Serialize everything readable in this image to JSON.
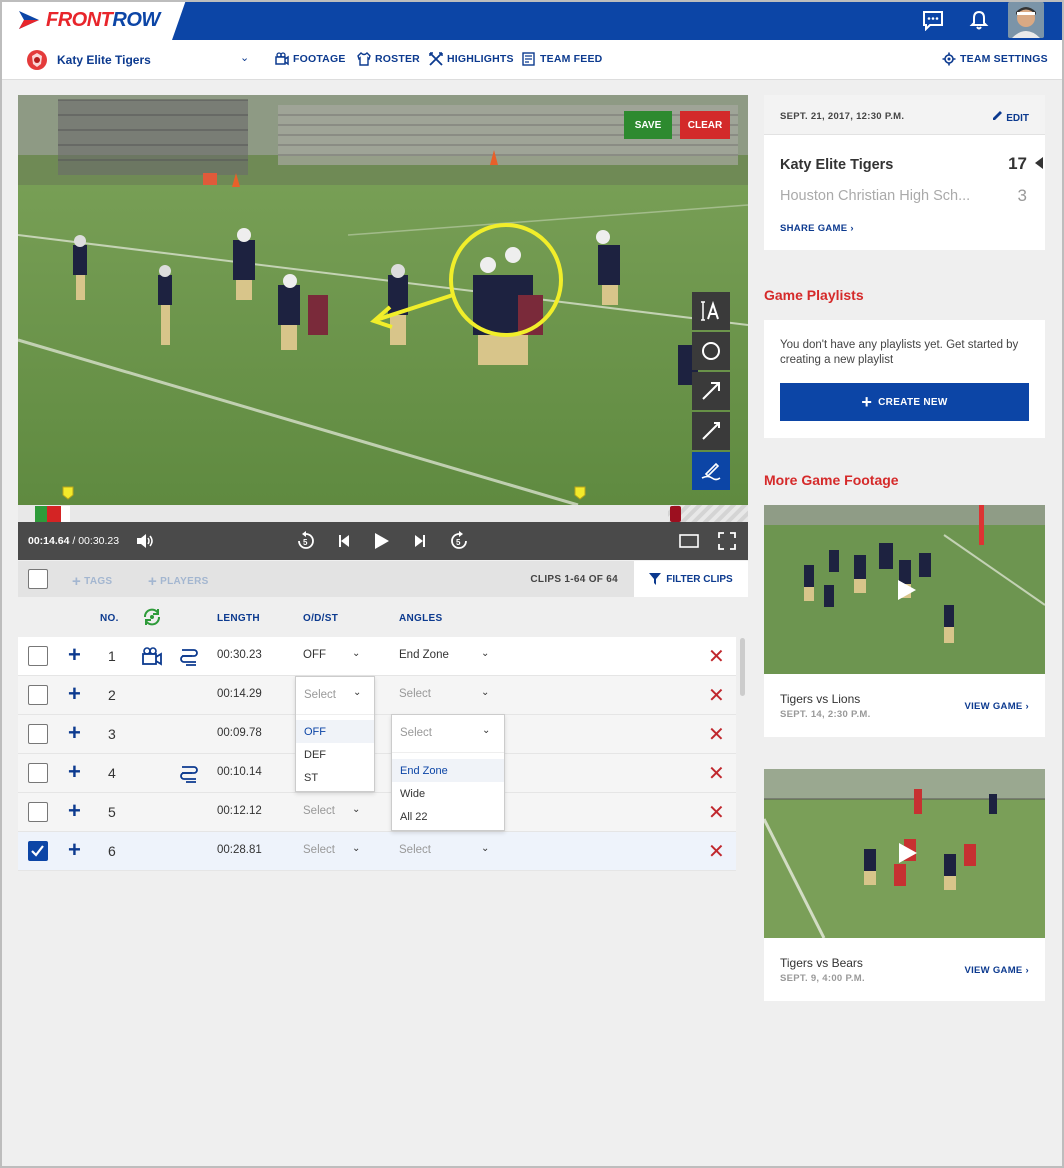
{
  "brand": {
    "part1": "FRONT",
    "part2": "ROW"
  },
  "team": {
    "name": "Katy Elite Tigers"
  },
  "nav": {
    "footage": "FOOTAGE",
    "roster": "ROSTER",
    "highlights": "HIGHLIGHTS",
    "team_feed": "TEAM FEED",
    "team_settings": "TEAM SETTINGS"
  },
  "video": {
    "save_label": "SAVE",
    "clear_label": "CLEAR",
    "current_time": "00:14.64",
    "separator": " / ",
    "total_time": "00:30.23",
    "progress_fraction": 0.484
  },
  "clip_toolbar": {
    "tags_label": "TAGS",
    "players_label": "PLAYERS",
    "count_text": "CLIPS 1-64 OF 64",
    "filter_label": "FILTER CLIPS"
  },
  "table": {
    "headers": {
      "no": "NO.",
      "length": "LENGTH",
      "odst": "O/D/ST",
      "angles": "ANGLES"
    },
    "rows": [
      {
        "no": "1",
        "length": "00:30.23",
        "odst": "OFF",
        "angle": "End Zone",
        "checked": false
      },
      {
        "no": "2",
        "length": "00:14.29",
        "odst": "Select",
        "angle": "Select",
        "checked": false
      },
      {
        "no": "3",
        "length": "00:09.78",
        "odst": "",
        "angle": "Select",
        "checked": false
      },
      {
        "no": "4",
        "length": "00:10.14",
        "odst": "",
        "angle": "",
        "checked": false
      },
      {
        "no": "5",
        "length": "00:12.12",
        "odst": "Select",
        "angle": "",
        "checked": false
      },
      {
        "no": "6",
        "length": "00:28.81",
        "odst": "Select",
        "angle": "Select",
        "checked": true
      }
    ],
    "odst_options": [
      "OFF",
      "DEF",
      "ST"
    ],
    "angle_options": [
      "End Zone",
      "Wide",
      "All 22"
    ]
  },
  "game": {
    "date": "SEPT. 21, 2017, 12:30 P.M.",
    "edit_label": "EDIT",
    "team1": "Katy Elite Tigers",
    "score1": "17",
    "team2": "Houston Christian High Sch...",
    "score2": "3",
    "share_label": "SHARE GAME"
  },
  "playlists": {
    "title": "Game Playlists",
    "empty_text": "You don't have any playlists yet. Get started by creating a new playlist",
    "create_label": "CREATE NEW"
  },
  "more_footage": {
    "title": "More Game Footage",
    "games": [
      {
        "title": "Tigers vs Lions",
        "date": "SEPT. 14, 2:30 P.M.",
        "view_label": "VIEW GAME"
      },
      {
        "title": "Tigers vs Bears",
        "date": "SEPT. 9, 4:00 P.M.",
        "view_label": "VIEW GAME"
      }
    ]
  },
  "colors": {
    "brand_blue": "#0c45a6",
    "brand_red": "#e8252b",
    "save_green": "#2d8a2f",
    "delete_red": "#c0272d"
  }
}
